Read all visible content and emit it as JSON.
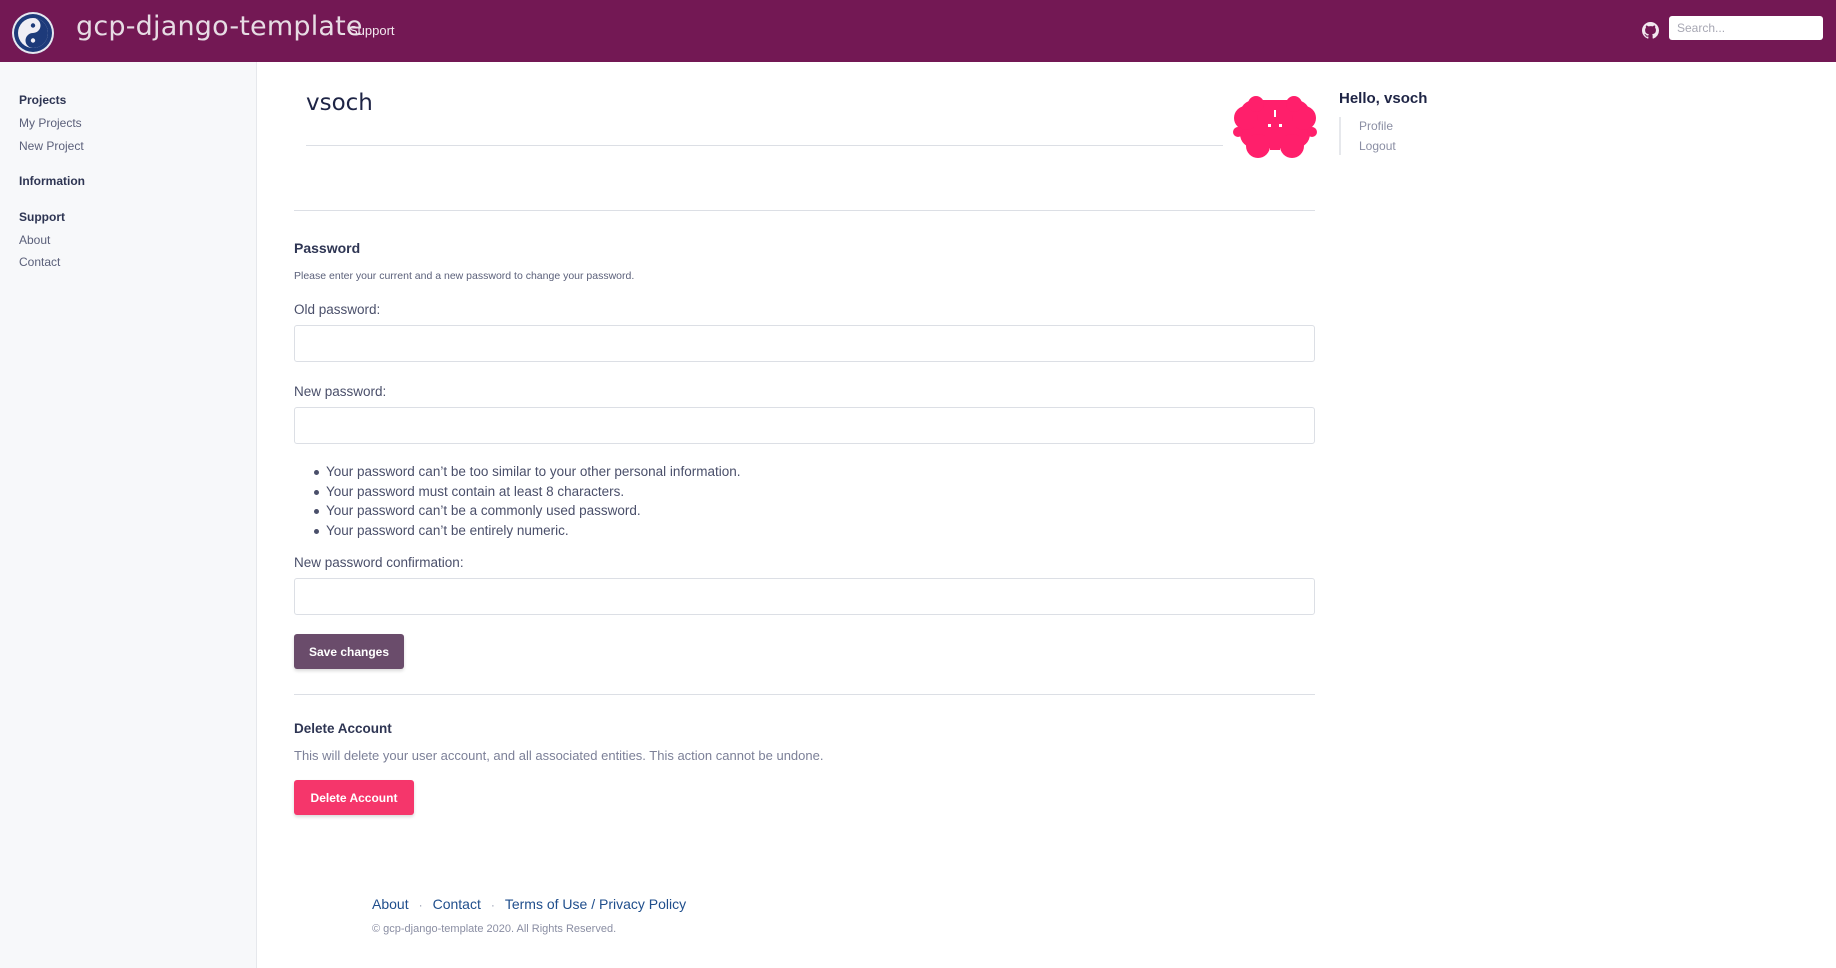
{
  "header": {
    "brand": "gcp-django-template",
    "nav_support": "Support",
    "search_placeholder": "Search..."
  },
  "sidebar": {
    "projects_heading": "Projects",
    "my_projects": "My Projects",
    "new_project": "New Project",
    "information_heading": "Information",
    "support_heading": "Support",
    "about": "About",
    "contact": "Contact"
  },
  "profile": {
    "username": "vsoch",
    "hello": "Hello, vsoch",
    "profile_link": "Profile",
    "logout_link": "Logout"
  },
  "password": {
    "title": "Password",
    "help": "Please enter your current and a new password to change your password.",
    "old_label": "Old password:",
    "new_label": "New password:",
    "rules": [
      "Your password can’t be too similar to your other personal information.",
      "Your password must contain at least 8 characters.",
      "Your password can’t be a commonly used password.",
      "Your password can’t be entirely numeric."
    ],
    "confirm_label": "New password confirmation:",
    "save_label": "Save changes"
  },
  "delete": {
    "title": "Delete Account",
    "text": "This will delete your user account, and all associated entities. This action cannot be undone.",
    "button_label": "Delete Account"
  },
  "footer": {
    "about": "About",
    "contact": "Contact",
    "terms": "Terms of Use / Privacy Policy",
    "copyright": "© gcp-django-template 2020. All Rights Reserved."
  },
  "colors": {
    "topbar": "#731854",
    "save_button": "#6a4c6b",
    "delete_button": "#f5366b",
    "avatar": "#ff1f6b"
  },
  "icons": {
    "logo": "logo-icon",
    "github": "github-icon"
  }
}
